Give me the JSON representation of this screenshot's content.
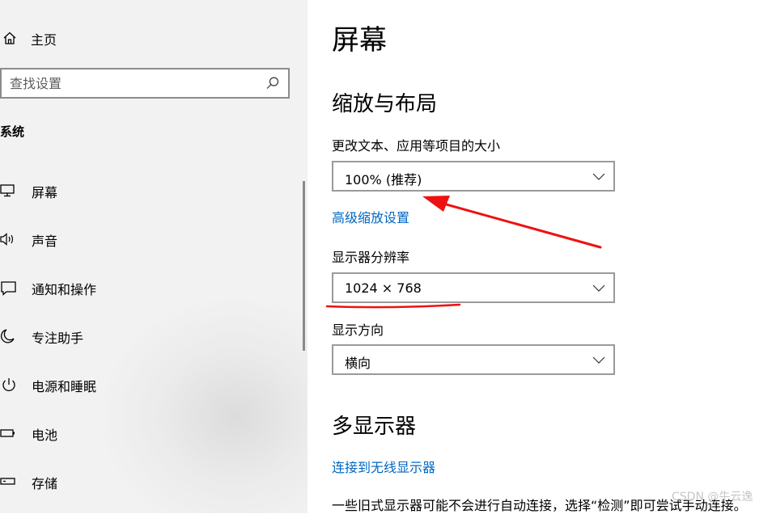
{
  "sidebar": {
    "home": {
      "label": "主页",
      "icon": "home-icon"
    },
    "search": {
      "placeholder": "查找设置",
      "icon": "search-icon"
    },
    "section_title": "系统",
    "items": [
      {
        "label": "屏幕",
        "icon": "monitor-icon"
      },
      {
        "label": "声音",
        "icon": "speaker-icon"
      },
      {
        "label": "通知和操作",
        "icon": "notification-icon"
      },
      {
        "label": "专注助手",
        "icon": "moon-icon"
      },
      {
        "label": "电源和睡眠",
        "icon": "power-icon"
      },
      {
        "label": "电池",
        "icon": "battery-icon"
      },
      {
        "label": "存储",
        "icon": "storage-icon"
      }
    ]
  },
  "main": {
    "title": "屏幕",
    "scale_section": {
      "heading": "缩放与布局",
      "scale_label": "更改文本、应用等项目的大小",
      "scale_value": "100% (推荐)",
      "advanced_link": "高级缩放设置",
      "resolution_label": "显示器分辨率",
      "resolution_value": "1024 × 768",
      "orientation_label": "显示方向",
      "orientation_value": "横向"
    },
    "multi_display": {
      "heading": "多显示器",
      "wireless_link": "连接到无线显示器",
      "description": "一些旧式显示器可能不会进行自动连接，选择“检测”即可尝试手动连接。"
    }
  },
  "watermark": "CSDN @牛云逸",
  "colors": {
    "link": "#0067c0",
    "annotation": "#ee1111",
    "sidebar_bg": "#f2f2f2"
  }
}
